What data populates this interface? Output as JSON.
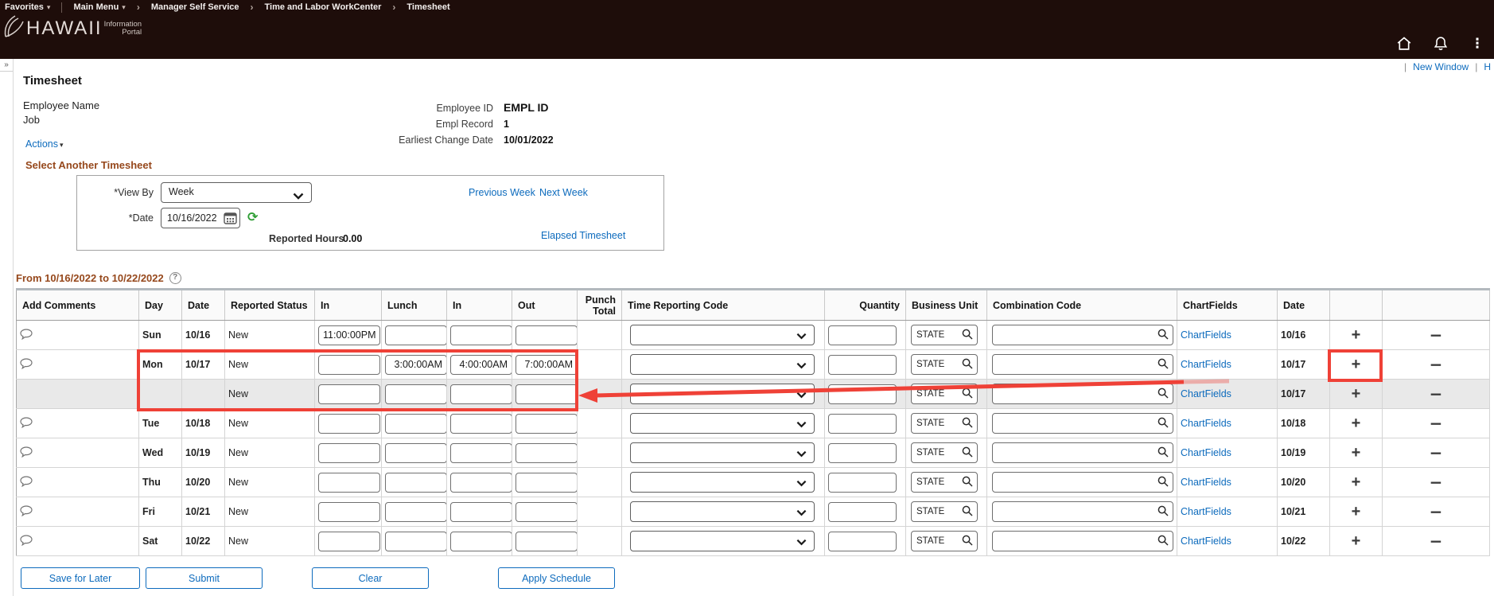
{
  "colors": {
    "header_bg": "#1e0d0a",
    "link_blue": "#0d6bbd",
    "section_heading_brown": "#96481c",
    "annotation_red": "#ef4137",
    "added_row_bg": "#e9e9e9"
  },
  "icons": {
    "caret_down": "▾",
    "breadcrumb_separator": "›",
    "expand": "»",
    "kebab": "⋮",
    "help": "?",
    "refresh": "⟳",
    "plus": "+",
    "minus": "−",
    "pipe": "|"
  },
  "breadcrumb": {
    "favorites": "Favorites",
    "main_menu": "Main Menu",
    "items": [
      "Manager Self Service",
      "Time and Labor WorkCenter",
      "Timesheet"
    ]
  },
  "logo": {
    "primary": "HAWAII",
    "secondary_top": "Information",
    "secondary_bottom": "Portal"
  },
  "window_links": {
    "new_window": "New Window",
    "help_partial": "H"
  },
  "page": {
    "title": "Timesheet",
    "employee_name": "Employee Name",
    "job_label": "Job",
    "actions_label": "Actions"
  },
  "employee_info": [
    {
      "label": "Employee ID",
      "value": "EMPL ID"
    },
    {
      "label": "Empl Record",
      "value": "1"
    },
    {
      "label": "Earliest Change Date",
      "value": "10/01/2022"
    }
  ],
  "selector": {
    "heading": "Select Another Timesheet",
    "view_by_label": "*View By",
    "view_by_value": "Week",
    "previous_week": "Previous Week",
    "next_week": "Next Week",
    "date_label": "*Date",
    "date_value": "10/16/2022",
    "reported_hours_label": "Reported Hours",
    "reported_hours_value": "0.00",
    "elapsed_link": "Elapsed Timesheet"
  },
  "grid": {
    "range_label": "From 10/16/2022 to 10/22/2022",
    "headers": {
      "add_comments": "Add Comments",
      "day": "Day",
      "date": "Date",
      "reported_status": "Reported Status",
      "in1": "In",
      "lunch": "Lunch",
      "in2": "In",
      "out": "Out",
      "punch_total": "Punch Total",
      "trc": "Time Reporting Code",
      "quantity": "Quantity",
      "business_unit": "Business Unit",
      "combination_code": "Combination Code",
      "chartfields": "ChartFields",
      "date2": "Date"
    },
    "rows": [
      {
        "day": "Sun",
        "date": "10/16",
        "status": "New",
        "in1": "11:00:00PM",
        "lunch": "",
        "in2": "",
        "out": "",
        "quantity": "",
        "business_unit": "STATE",
        "combination_code": "",
        "chartfields_label": "ChartFields",
        "row_date": "10/16"
      },
      {
        "day": "Mon",
        "date": "10/17",
        "status": "New",
        "in1": "",
        "lunch": "3:00:00AM",
        "in2": "4:00:00AM",
        "out": "7:00:00AM",
        "quantity": "",
        "business_unit": "STATE",
        "combination_code": "",
        "chartfields_label": "ChartFields",
        "row_date": "10/17"
      },
      {
        "day": "",
        "date": "",
        "status": "New",
        "in1": "",
        "lunch": "",
        "in2": "",
        "out": "",
        "quantity": "",
        "business_unit": "STATE",
        "combination_code": "",
        "chartfields_label": "ChartFields",
        "row_date": "10/17"
      },
      {
        "day": "Tue",
        "date": "10/18",
        "status": "New",
        "in1": "",
        "lunch": "",
        "in2": "",
        "out": "",
        "quantity": "",
        "business_unit": "STATE",
        "combination_code": "",
        "chartfields_label": "ChartFields",
        "row_date": "10/18"
      },
      {
        "day": "Wed",
        "date": "10/19",
        "status": "New",
        "in1": "",
        "lunch": "",
        "in2": "",
        "out": "",
        "quantity": "",
        "business_unit": "STATE",
        "combination_code": "",
        "chartfields_label": "ChartFields",
        "row_date": "10/19"
      },
      {
        "day": "Thu",
        "date": "10/20",
        "status": "New",
        "in1": "",
        "lunch": "",
        "in2": "",
        "out": "",
        "quantity": "",
        "business_unit": "STATE",
        "combination_code": "",
        "chartfields_label": "ChartFields",
        "row_date": "10/20"
      },
      {
        "day": "Fri",
        "date": "10/21",
        "status": "New",
        "in1": "",
        "lunch": "",
        "in2": "",
        "out": "",
        "quantity": "",
        "business_unit": "STATE",
        "combination_code": "",
        "chartfields_label": "ChartFields",
        "row_date": "10/21"
      },
      {
        "day": "Sat",
        "date": "10/22",
        "status": "New",
        "in1": "",
        "lunch": "",
        "in2": "",
        "out": "",
        "quantity": "",
        "business_unit": "STATE",
        "combination_code": "",
        "chartfields_label": "ChartFields",
        "row_date": "10/22"
      }
    ]
  },
  "footer_buttons": {
    "save_for_later": "Save for Later",
    "submit": "Submit",
    "clear": "Clear",
    "apply_schedule": "Apply Schedule"
  }
}
